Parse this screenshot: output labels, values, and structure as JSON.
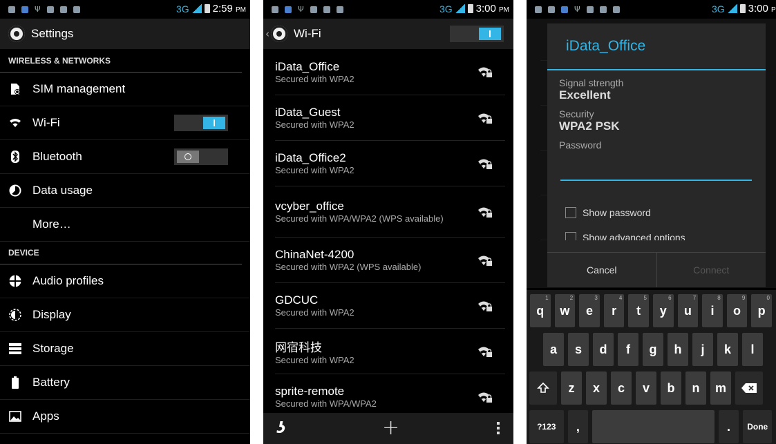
{
  "screen1": {
    "status": {
      "network": "3G",
      "time": "2:59",
      "ampm": "PM"
    },
    "title": "Settings",
    "sections": [
      {
        "header": "WIRELESS & NETWORKS",
        "items": [
          {
            "label": "SIM management",
            "icon": "sim-card-icon"
          },
          {
            "label": "Wi-Fi",
            "icon": "wifi-icon",
            "toggle": "on"
          },
          {
            "label": "Bluetooth",
            "icon": "bluetooth-icon",
            "toggle": "off"
          },
          {
            "label": "Data usage",
            "icon": "data-usage-icon"
          },
          {
            "label": "More…",
            "icon": ""
          }
        ]
      },
      {
        "header": "DEVICE",
        "items": [
          {
            "label": "Audio profiles",
            "icon": "audio-profiles-icon"
          },
          {
            "label": "Display",
            "icon": "display-icon"
          },
          {
            "label": "Storage",
            "icon": "storage-icon"
          },
          {
            "label": "Battery",
            "icon": "battery-icon"
          },
          {
            "label": "Apps",
            "icon": "apps-icon"
          }
        ]
      }
    ]
  },
  "screen2": {
    "status": {
      "network": "3G",
      "time": "3:00",
      "ampm": "PM"
    },
    "title": "Wi-Fi",
    "wifi_toggle": "on",
    "networks": [
      {
        "name": "iData_Office",
        "security": "Secured with WPA2"
      },
      {
        "name": "iData_Guest",
        "security": "Secured with WPA2"
      },
      {
        "name": "iData_Office2",
        "security": "Secured with WPA2"
      },
      {
        "name": "vcyber_office",
        "security": "Secured with WPA/WPA2 (WPS available)"
      },
      {
        "name": "ChinaNet-4200",
        "security": "Secured with WPA2 (WPS available)"
      },
      {
        "name": "GDCUC",
        "security": "Secured with WPA2"
      },
      {
        "name": "网宿科技",
        "security": "Secured with WPA2"
      },
      {
        "name": "sprite-remote",
        "security": "Secured with WPA/WPA2"
      }
    ],
    "bottom_icons": [
      "scan-icon",
      "add-network-icon",
      "overflow-menu-icon"
    ]
  },
  "screen3": {
    "status": {
      "network": "3G",
      "time": "3:00",
      "ampm": "PM"
    },
    "dialog": {
      "title": "iData_Office",
      "signal_label": "Signal strength",
      "signal_value": "Excellent",
      "security_label": "Security",
      "security_value": "WPA2 PSK",
      "password_label": "Password",
      "show_password": "Show password",
      "show_advanced": "Show advanced options",
      "cancel": "Cancel",
      "connect": "Connect"
    },
    "keyboard": {
      "row1": [
        [
          "q",
          "1"
        ],
        [
          "w",
          "2"
        ],
        [
          "e",
          "3"
        ],
        [
          "r",
          "4"
        ],
        [
          "t",
          "5"
        ],
        [
          "y",
          "6"
        ],
        [
          "u",
          "7"
        ],
        [
          "i",
          "8"
        ],
        [
          "o",
          "9"
        ],
        [
          "p",
          "0"
        ]
      ],
      "row2": [
        "a",
        "s",
        "d",
        "f",
        "g",
        "h",
        "j",
        "k",
        "l"
      ],
      "row3": [
        "z",
        "x",
        "c",
        "v",
        "b",
        "n",
        "m"
      ],
      "symbols": "?123",
      "comma": ",",
      "period": ".",
      "done": "Done"
    }
  },
  "colors": {
    "accent": "#33b5e5",
    "background": "#000000",
    "actionbar": "#1c1c1c"
  }
}
